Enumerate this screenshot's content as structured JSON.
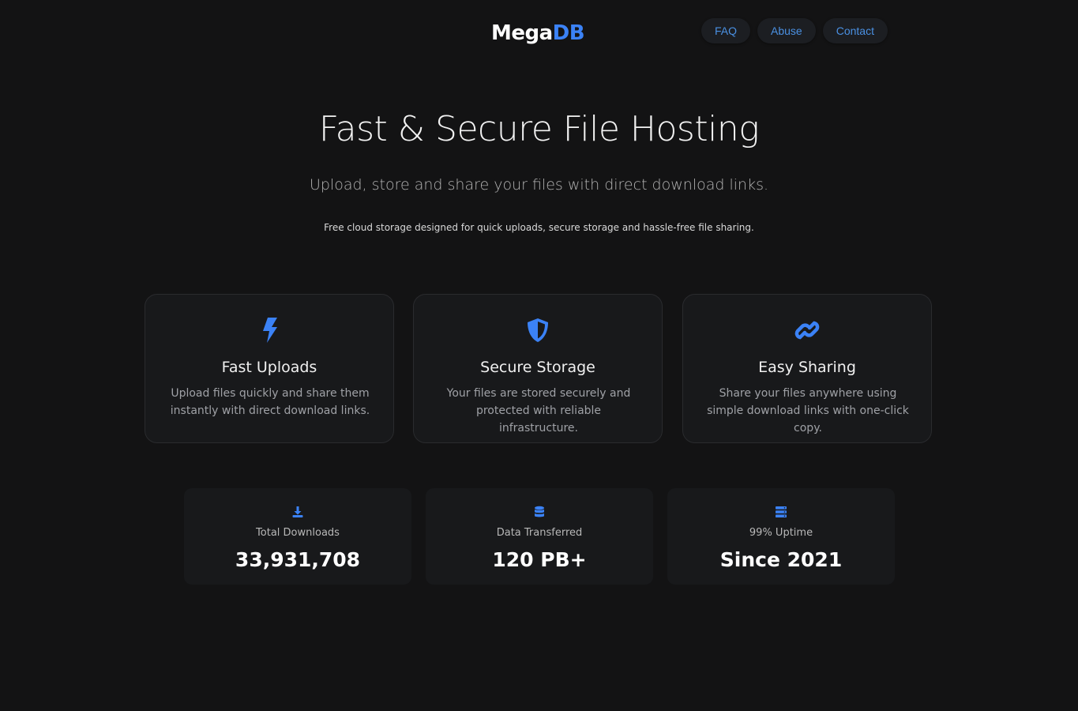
{
  "header": {
    "logo_main": "Mega",
    "logo_accent": "DB",
    "nav": [
      {
        "label": "FAQ"
      },
      {
        "label": "Abuse"
      },
      {
        "label": "Contact"
      }
    ]
  },
  "hero": {
    "title": "Fast & Secure File Hosting",
    "subtitle": "Upload, store and share your files with direct download links.",
    "description": "Free cloud storage designed for quick uploads, secure storage and hassle-free file sharing."
  },
  "features": [
    {
      "icon": "bolt-icon",
      "title": "Fast Uploads",
      "text": "Upload files quickly and share them instantly with direct download links."
    },
    {
      "icon": "shield-icon",
      "title": "Secure Storage",
      "text": "Your files are stored securely and protected with reliable infrastructure."
    },
    {
      "icon": "link-icon",
      "title": "Easy Sharing",
      "text": "Share your files anywhere using simple download links with one-click copy."
    }
  ],
  "stats": [
    {
      "icon": "download-icon",
      "label": "Total Downloads",
      "value": "33,931,708"
    },
    {
      "icon": "database-icon",
      "label": "Data Transferred",
      "value": "120 PB+"
    },
    {
      "icon": "server-icon",
      "label": "99% Uptime",
      "value": "Since 2021"
    }
  ],
  "colors": {
    "background": "#131314",
    "accent": "#3b82f6",
    "card": "#18191b"
  }
}
